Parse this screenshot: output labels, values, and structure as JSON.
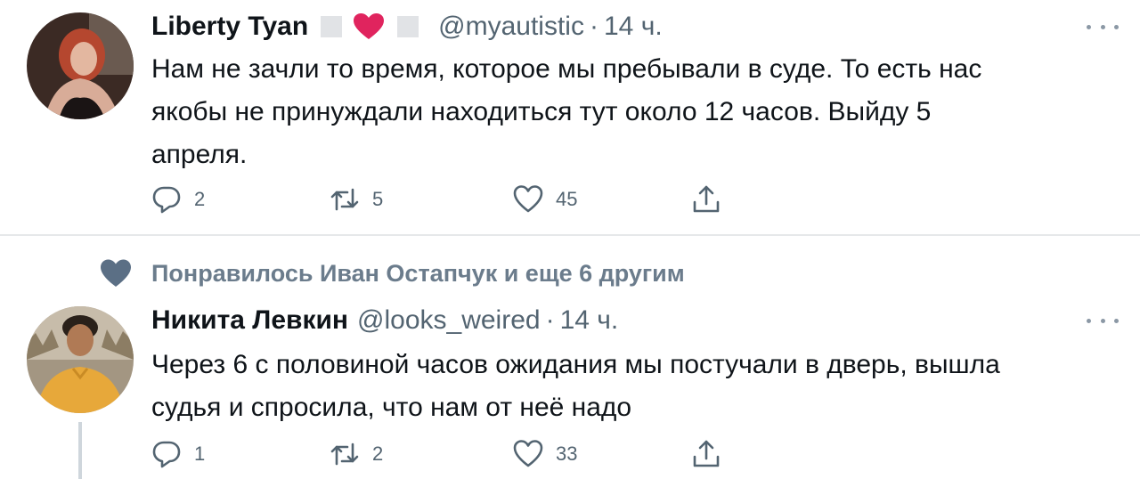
{
  "tweet1": {
    "author_name": "Liberty Tyan",
    "handle": "@myautistic",
    "separator": "·",
    "time": "14 ч.",
    "text_lines": [
      "Нам не зачли то время, которое мы пребывали в суде. То есть нас",
      "якобы не принуждали находиться тут около 12 часов. Выйду 5",
      "апреля."
    ],
    "replies": "2",
    "retweets": "5",
    "likes": "45"
  },
  "liked_by": {
    "text": "Понравилось Иван Остапчук и еще 6 другим"
  },
  "tweet2": {
    "author_name": "Никита Левкин",
    "handle": "@looks_weired",
    "separator": "·",
    "time": "14 ч.",
    "text_lines": [
      "Через 6 с половиной часов ожидания мы постучали в дверь, вышла",
      "судья и спросила, что нам от неё надо"
    ],
    "replies": "1",
    "retweets": "2",
    "likes": "33"
  },
  "colors": {
    "text": "#0f1419",
    "secondary": "#536471",
    "heart_badge": "#e0245e",
    "divider": "#e6e8ea"
  },
  "icons": [
    "reply-icon",
    "retweet-icon",
    "like-icon",
    "share-icon",
    "more-icon",
    "heart-icon"
  ]
}
